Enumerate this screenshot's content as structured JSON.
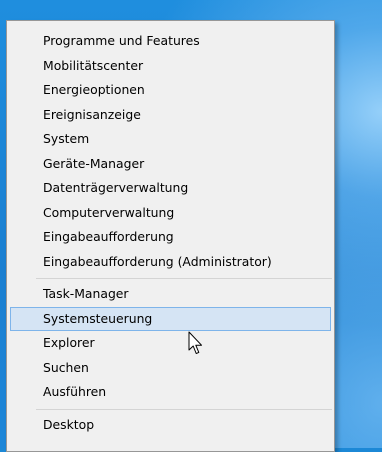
{
  "menu": {
    "items": [
      "Programme und Features",
      "Mobilitätscenter",
      "Energieoptionen",
      "Ereignisanzeige",
      "System",
      "Geräte-Manager",
      "Datenträgerverwaltung",
      "Computerverwaltung",
      "Eingabeaufforderung",
      "Eingabeaufforderung (Administrator)",
      "Task-Manager",
      "Systemsteuerung",
      "Explorer",
      "Suchen",
      "Ausführen",
      "Desktop"
    ],
    "highlighted": "Systemsteuerung"
  },
  "colors": {
    "desktop": "#1a7fd1",
    "menu_background": "#f0f0f0",
    "highlight_fill": "#d5e4f4",
    "highlight_border": "#7eb4ea"
  },
  "icons": {
    "cursor": "mouse-pointer-icon"
  }
}
